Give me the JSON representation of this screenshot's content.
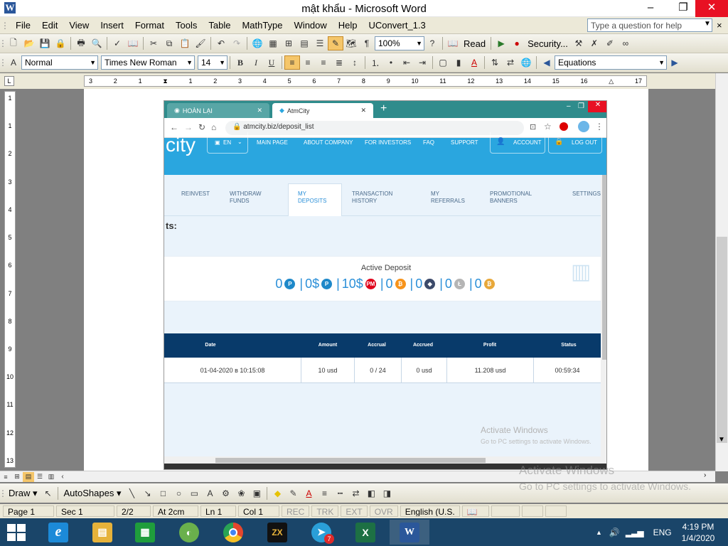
{
  "window": {
    "title": "mật khẩu - Microsoft Word",
    "min": "–",
    "max": "❐",
    "close": "✕"
  },
  "menu": {
    "items": [
      "File",
      "Edit",
      "View",
      "Insert",
      "Format",
      "Tools",
      "Table",
      "MathType",
      "Window",
      "Help",
      "UConvert_1.3"
    ],
    "help_placeholder": "Type a question for help",
    "close_doc": "×"
  },
  "toolbar1": {
    "zoom": "100%",
    "read": "Read",
    "security": "Security..."
  },
  "toolbar2": {
    "style": "Normal",
    "font": "Times New Roman",
    "size": "14",
    "bold": "B",
    "italic": "I",
    "underline": "U",
    "equations": "Equations"
  },
  "ruler": {
    "marks": [
      "3",
      "2",
      "1",
      "",
      "1",
      "2",
      "3",
      "4",
      "5",
      "6",
      "7",
      "8",
      "9",
      "10",
      "11",
      "12",
      "13",
      "14",
      "15",
      "16",
      "17"
    ]
  },
  "vruler": {
    "marks": [
      "1",
      "",
      "1",
      "2",
      "3",
      "4",
      "5",
      "6",
      "7",
      "8",
      "9",
      "10",
      "11",
      "12",
      "13"
    ]
  },
  "browser": {
    "tabs": [
      {
        "label": "HOÀN LẠI",
        "close": "✕"
      },
      {
        "label": "AtmCity",
        "close": "✕"
      }
    ],
    "new_tab": "+",
    "url": "atmcity.biz/deposit_list",
    "logo": "city",
    "lang": "EN",
    "nav": [
      "MAIN PAGE",
      "ABOUT COMPANY",
      "FOR INVESTORS",
      "FAQ",
      "SUPPORT"
    ],
    "account": "ACCOUNT",
    "logout": "LOG OUT",
    "subtabs": [
      {
        "l1": "REINVEST",
        "l2": ""
      },
      {
        "l1": "WITHDRAW",
        "l2": "FUNDS"
      },
      {
        "l1": "MY",
        "l2": "DEPOSITS"
      },
      {
        "l1": "TRANSACTION",
        "l2": "HISTORY"
      },
      {
        "l1": "MY",
        "l2": "REFERRALS"
      },
      {
        "l1": "PROMOTIONAL",
        "l2": "BANNERS"
      },
      {
        "l1": "SETTINGS",
        "l2": ""
      }
    ],
    "section_title": "ts:",
    "deposit": {
      "title": "Active Deposit",
      "values": [
        "0",
        "0$",
        "10$",
        "0",
        "0",
        "0",
        "0"
      ],
      "coins": [
        {
          "label": "P",
          "color": "#1e88c9"
        },
        {
          "label": "P",
          "color": "#1e88c9"
        },
        {
          "label": "PM",
          "color": "#e0001b"
        },
        {
          "label": "₿",
          "color": "#f7931a"
        },
        {
          "label": "◆",
          "color": "#3c4a6a"
        },
        {
          "label": "Ł",
          "color": "#b5b5b5"
        },
        {
          "label": "₿",
          "color": "#e8a83a"
        }
      ]
    },
    "table": {
      "headers": [
        "Date",
        "Amount",
        "Accrual",
        "Accrued",
        "Profit",
        "Status"
      ],
      "row": [
        "01-04-2020 в 10:15:08",
        "10 usd",
        "0 / 24",
        "0 usd",
        "11.208 usd",
        "00:59:34"
      ]
    },
    "watermark": {
      "line1": "Activate Windows",
      "line2": "Go to PC settings to activate Windows."
    }
  },
  "drawbar": {
    "draw": "Draw",
    "autoshapes": "AutoShapes"
  },
  "status": {
    "page": "Page  1",
    "sec": "Sec  1",
    "pages": "2/2",
    "at": "At  2cm",
    "ln": "Ln  1",
    "col": "Col  1",
    "rec": "REC",
    "trk": "TRK",
    "ext": "EXT",
    "ovr": "OVR",
    "lang": "English (U.S."
  },
  "watermark": {
    "line1": "Activate Windows",
    "line2": "Go to PC settings to activate Windows."
  },
  "taskbar": {
    "apps": [
      {
        "name": "ie",
        "glyph": "e",
        "color": "#1c8ad8"
      },
      {
        "name": "explorer",
        "glyph": "▤",
        "color": "#e6b23a"
      },
      {
        "name": "store",
        "glyph": "▦",
        "color": "#1f9d3c"
      },
      {
        "name": "coccoc",
        "glyph": "◐",
        "color": "#6ab04c"
      },
      {
        "name": "chrome",
        "glyph": "●",
        "color": "#e4462e"
      },
      {
        "name": "zx",
        "glyph": "ZX",
        "color": "#111111"
      },
      {
        "name": "telegram",
        "glyph": "➤",
        "color": "#2a9fd8"
      },
      {
        "name": "excel",
        "glyph": "X",
        "color": "#1d7044"
      },
      {
        "name": "word",
        "glyph": "W",
        "color": "#2b579a"
      }
    ],
    "telegram_badge": "7",
    "lang": "ENG",
    "time": "4:19 PM",
    "date": "1/4/2020"
  }
}
